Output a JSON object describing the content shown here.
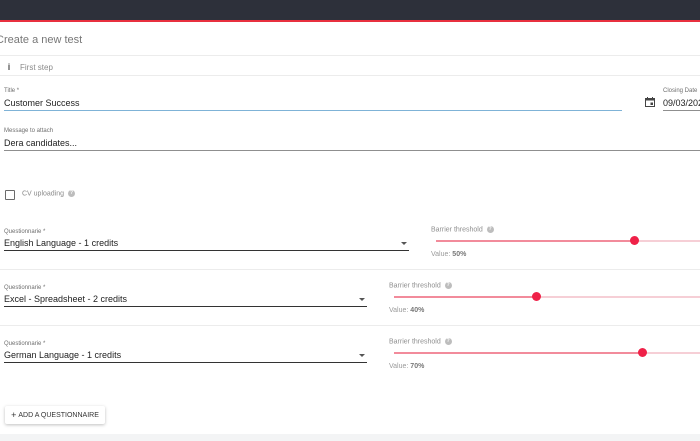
{
  "page": {
    "title": "Create a new test",
    "step": "First step"
  },
  "form": {
    "title": {
      "label": "Title *",
      "value": "Customer Success"
    },
    "closing_date": {
      "label": "Closing Date",
      "value": "09/03/202"
    },
    "message": {
      "label": "Message to attach",
      "value": "Dera candidates..."
    },
    "cv_uploading": {
      "label": "CV uploading",
      "checked": false
    }
  },
  "questionnaires": [
    {
      "label": "Questionnarie *",
      "value": "English Language - 1 credits",
      "threshold_label": "Barrier threshold",
      "value_prefix": "Value:",
      "value_text": "50%",
      "fraction": 0.5
    },
    {
      "label": "Questionnarie *",
      "value": "Excel - Spreadsheet - 2 credits",
      "threshold_label": "Barrier threshold",
      "value_prefix": "Value:",
      "value_text": "40%",
      "fraction": 0.4
    },
    {
      "label": "Questionnarie *",
      "value": "German Language - 1 credits",
      "threshold_label": "Barrier threshold",
      "value_prefix": "Value:",
      "value_text": "70%",
      "fraction": 0.7
    }
  ],
  "add_button": {
    "plus": "+",
    "label": "ADD A QUESTIONNAIRE"
  },
  "icons": {
    "info": "info-icon",
    "calendar": "calendar-icon",
    "help": "help-icon",
    "dropdown": "chevron-down-icon"
  },
  "colors": {
    "accent": "#ef2148",
    "topbar": "#2d303a",
    "focus": "#7fb3d7"
  }
}
